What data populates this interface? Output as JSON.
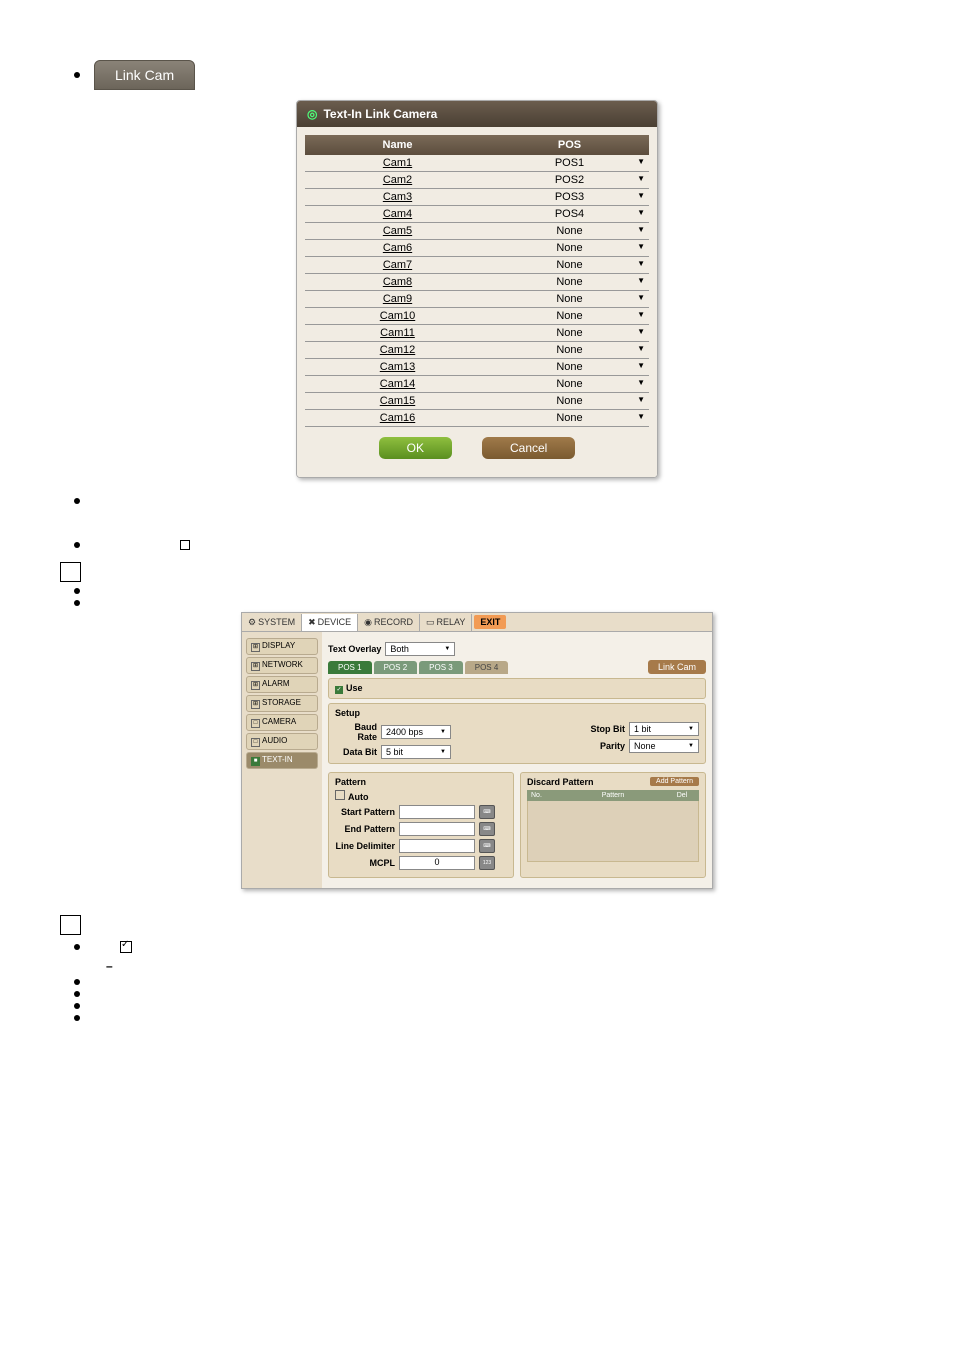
{
  "linkcam_tab": "Link Cam",
  "modal": {
    "title": "Text-In Link Camera",
    "col_name": "Name",
    "col_pos": "POS",
    "rows": [
      {
        "name": "Cam1",
        "pos": "POS1"
      },
      {
        "name": "Cam2",
        "pos": "POS2"
      },
      {
        "name": "Cam3",
        "pos": "POS3"
      },
      {
        "name": "Cam4",
        "pos": "POS4"
      },
      {
        "name": "Cam5",
        "pos": "None"
      },
      {
        "name": "Cam6",
        "pos": "None"
      },
      {
        "name": "Cam7",
        "pos": "None"
      },
      {
        "name": "Cam8",
        "pos": "None"
      },
      {
        "name": "Cam9",
        "pos": "None"
      },
      {
        "name": "Cam10",
        "pos": "None"
      },
      {
        "name": "Cam11",
        "pos": "None"
      },
      {
        "name": "Cam12",
        "pos": "None"
      },
      {
        "name": "Cam13",
        "pos": "None"
      },
      {
        "name": "Cam14",
        "pos": "None"
      },
      {
        "name": "Cam15",
        "pos": "None"
      },
      {
        "name": "Cam16",
        "pos": "None"
      }
    ],
    "ok": "OK",
    "cancel": "Cancel"
  },
  "cfg": {
    "tabs": {
      "system": "SYSTEM",
      "device": "DEVICE",
      "record": "RECORD",
      "relay": "RELAY",
      "exit": "EXIT"
    },
    "side": {
      "display": "DISPLAY",
      "network": "NETWORK",
      "alarm": "ALARM",
      "storage": "STORAGE",
      "camera": "CAMERA",
      "audio": "AUDIO",
      "textin": "TEXT-IN"
    },
    "text_overlay_lbl": "Text Overlay",
    "text_overlay_val": "Both",
    "pos": {
      "1": "POS 1",
      "2": "POS 2",
      "3": "POS 3",
      "4": "POS 4"
    },
    "link_cam": "Link Cam",
    "use": "Use",
    "setup": "Setup",
    "baud_rate_lbl": "Baud Rate",
    "baud_rate_val": "2400 bps",
    "data_bit_lbl": "Data Bit",
    "data_bit_val": "5 bit",
    "stop_bit_lbl": "Stop Bit",
    "stop_bit_val": "1 bit",
    "parity_lbl": "Parity",
    "parity_val": "None",
    "pattern": "Pattern",
    "auto": "Auto",
    "start_pattern": "Start Pattern",
    "end_pattern": "End Pattern",
    "line_delim": "Line Delimiter",
    "mcpl": "MCPL",
    "mcpl_val": "0",
    "discard": "Discard Pattern",
    "add_pattern": "Add Pattern",
    "dp_no": "No.",
    "dp_pat": "Pattern",
    "dp_del": "Del"
  }
}
